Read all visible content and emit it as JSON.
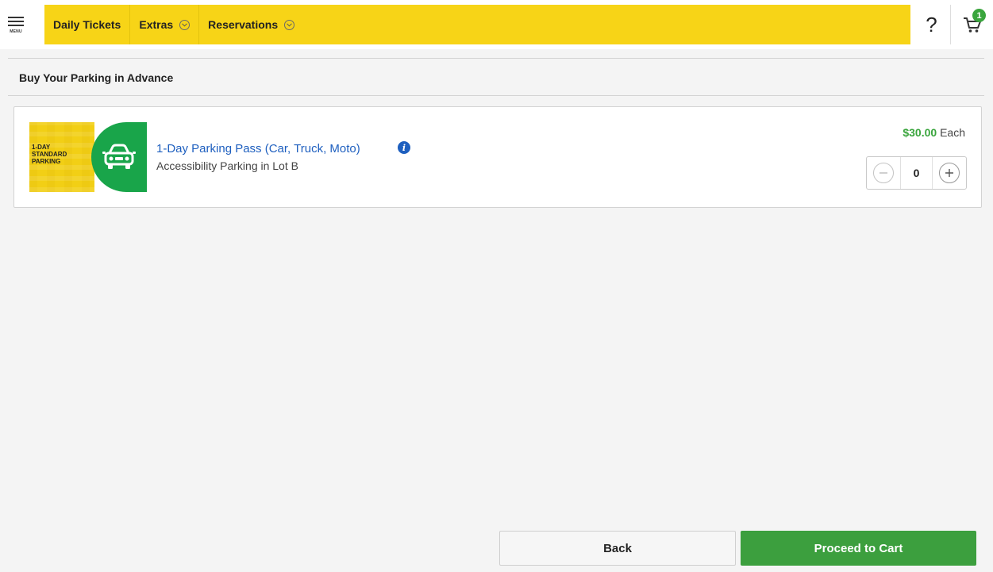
{
  "header": {
    "menu_label": "MENU",
    "menu_icon": "hamburger-icon",
    "nav": {
      "daily_tickets": "Daily Tickets",
      "extras": "Extras",
      "reservations": "Reservations"
    },
    "help_label": "?",
    "cart_icon": "cart-icon",
    "cart_count": "1"
  },
  "page": {
    "title": "Buy Your Parking in Advance"
  },
  "product": {
    "thumbnail_text": [
      "1-DAY",
      "STANDARD",
      "PARKING"
    ],
    "thumbnail_icon": "car-icon",
    "title": "1-Day Parking Pass (Car, Truck, Moto)",
    "info_icon": "info-icon",
    "subtitle": "Accessibility Parking in Lot B",
    "price": "$30.00",
    "price_suffix": "Each",
    "quantity": "0"
  },
  "footer": {
    "back_label": "Back",
    "proceed_label": "Proceed to Cart"
  },
  "colors": {
    "nav_yellow": "#f7d417",
    "accent_green": "#3c9f3e",
    "link_blue": "#1e5fbf"
  }
}
